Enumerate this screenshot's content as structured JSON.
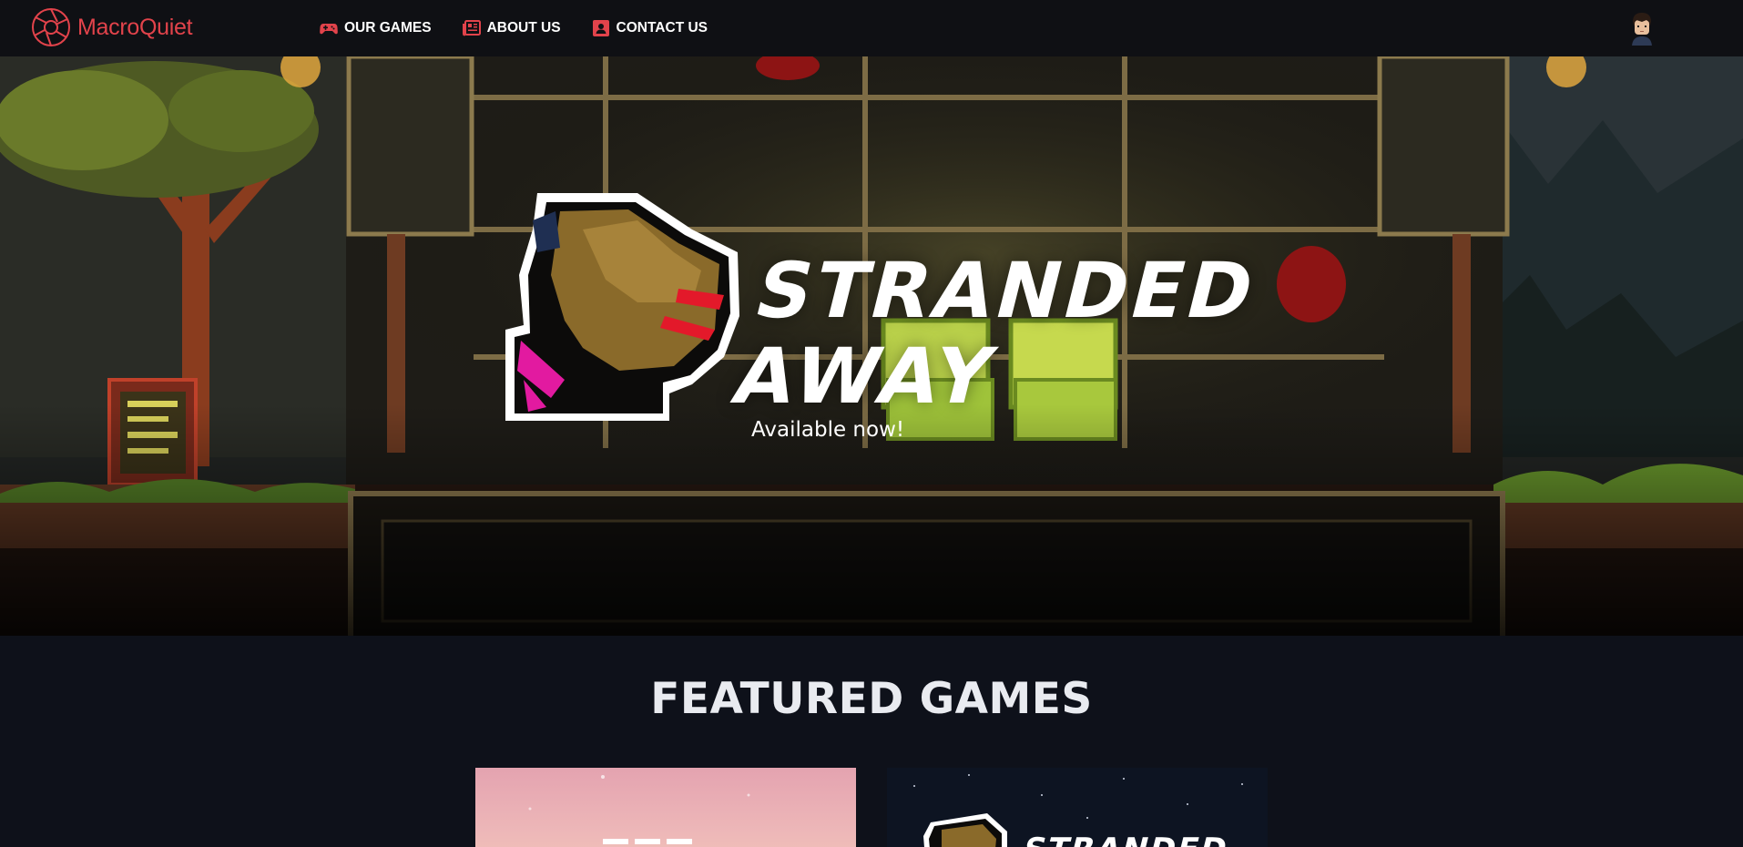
{
  "brand": {
    "name": "MacroQuiet"
  },
  "nav": {
    "items": [
      {
        "label": "OUR GAMES",
        "icon": "gamepad-icon"
      },
      {
        "label": "ABOUT US",
        "icon": "newspaper-icon"
      },
      {
        "label": "CONTACT US",
        "icon": "contact-card-icon"
      }
    ]
  },
  "hero": {
    "title_line1": "STRANDED",
    "title_line2": "AWAY",
    "subtitle": "Available now!"
  },
  "featured": {
    "title": "FEATURED GAMES",
    "cards": [
      {
        "name": "featured-game-card-1"
      },
      {
        "name": "featured-game-card-2",
        "title": "STRANDED"
      }
    ]
  },
  "colors": {
    "accent": "#e2434b",
    "navbar_bg": "#0f1014",
    "page_bg": "#0e111a"
  }
}
